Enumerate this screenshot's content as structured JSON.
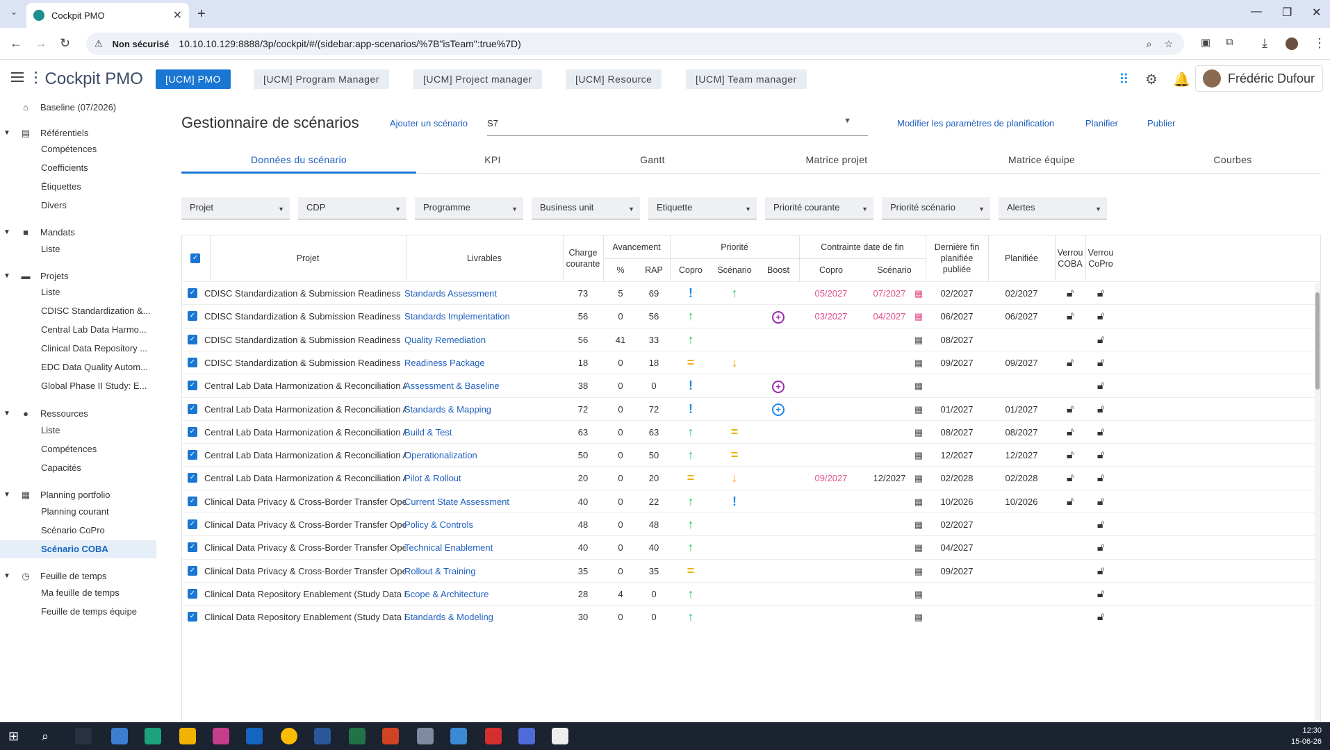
{
  "browser": {
    "tab_title": "Cockpit PMO",
    "security": "Non sécurisé",
    "url": "10.10.10.129:8888/3p/cockpit/#/(sidebar:app-scenarios/%7B\"isTeam\":true%7D)"
  },
  "app": {
    "title": "Cockpit PMO",
    "roles": [
      "[UCM] PMO",
      "[UCM] Program Manager",
      "[UCM] Project manager",
      "[UCM] Resource",
      "[UCM] Team manager"
    ],
    "user": "Frédéric Dufour"
  },
  "sidebar": {
    "baseline": "Baseline (07/2026)",
    "sections": [
      {
        "label": "Référentiels",
        "items": [
          "Compétences",
          "Coefficients",
          "Étiquettes",
          "Divers"
        ]
      },
      {
        "label": "Mandats",
        "items": [
          "Liste"
        ]
      },
      {
        "label": "Projets",
        "items": [
          "Liste",
          "CDISC Standardization &...",
          "Central Lab Data Harmo...",
          "Clinical Data Repository ...",
          "EDC Data Quality Autom...",
          "Global Phase II Study: E..."
        ]
      },
      {
        "label": "Ressources",
        "items": [
          "Liste",
          "Compétences",
          "Capacités"
        ]
      },
      {
        "label": "Planning portfolio",
        "items": [
          "Planning courant",
          "Scénario CoPro",
          "Scénario COBA"
        ]
      },
      {
        "label": "Feuille de temps",
        "items": [
          "Ma feuille de temps",
          "Feuille de temps équipe"
        ]
      }
    ]
  },
  "page": {
    "title": "Gestionnaire de scénarios",
    "add_link": "Ajouter un scénario",
    "scenario": "S7",
    "modify_link": "Modifier les paramètres de planification",
    "plan_link": "Planifier",
    "publish_link": "Publier"
  },
  "tabs": [
    "Données du scénario",
    "KPI",
    "Gantt",
    "Matrice projet",
    "Matrice équipe",
    "Courbes"
  ],
  "filters": [
    "Projet",
    "CDP",
    "Programme",
    "Business unit",
    "Etiquette",
    "Priorité courante",
    "Priorité scénario",
    "Alertes"
  ],
  "headers": {
    "projet": "Projet",
    "livrables": "Livrables",
    "charge": "Charge courante",
    "avancement": "Avancement",
    "pct": "%",
    "rap": "RAP",
    "priorite": "Priorité",
    "copro": "Copro",
    "scenario": "Scénario",
    "boost": "Boost",
    "contrainte": "Contrainte date de fin",
    "c_copro": "Copro",
    "c_scenario": "Scénario",
    "derniere": "Dernière fin planifiée publiée",
    "planifiee": "Planifiée",
    "verrou_coba": "Verrou COBA",
    "verrou_copro": "Verrou CoPro"
  },
  "rows": [
    {
      "projet": "CDISC Standardization & Submission Readiness",
      "livrable": "Standards Assessment",
      "charge": "73",
      "pct": "5",
      "rap": "69",
      "copro": "excl",
      "scen": "up",
      "boost": "",
      "c_copro": "05/2027",
      "c_scen": "07/2027",
      "cal": "pink",
      "derniere": "02/2027",
      "planifiee": "02/2027",
      "l1": true,
      "l2": true
    },
    {
      "projet": "CDISC Standardization & Submission Readiness",
      "livrable": "Standards Implementation",
      "charge": "56",
      "pct": "0",
      "rap": "56",
      "copro": "up",
      "scen": "",
      "boost": "purple",
      "c_copro": "03/2027",
      "c_scen": "04/2027",
      "cal": "pink",
      "derniere": "06/2027",
      "planifiee": "06/2027",
      "l1": true,
      "l2": true
    },
    {
      "projet": "CDISC Standardization & Submission Readiness",
      "livrable": "Quality Remediation",
      "charge": "56",
      "pct": "41",
      "rap": "33",
      "copro": "up",
      "scen": "",
      "boost": "",
      "c_copro": "",
      "c_scen": "",
      "cal": "gray",
      "derniere": "08/2027",
      "planifiee": "",
      "l1": false,
      "l2": true
    },
    {
      "projet": "CDISC Standardization & Submission Readiness",
      "livrable": "Readiness Package",
      "charge": "18",
      "pct": "0",
      "rap": "18",
      "copro": "eq",
      "scen": "down",
      "boost": "",
      "c_copro": "",
      "c_scen": "",
      "cal": "gray",
      "derniere": "09/2027",
      "planifiee": "09/2027",
      "l1": true,
      "l2": true
    },
    {
      "projet": "Central Lab Data Harmonization & Reconciliation Accelerat...",
      "livrable": "Assessment & Baseline",
      "charge": "38",
      "pct": "0",
      "rap": "0",
      "copro": "excl",
      "scen": "",
      "boost": "purple",
      "c_copro": "",
      "c_scen": "",
      "cal": "gray",
      "derniere": "",
      "planifiee": "",
      "l1": false,
      "l2": true
    },
    {
      "projet": "Central Lab Data Harmonization & Reconciliation Accelerat...",
      "livrable": "Standards & Mapping",
      "charge": "72",
      "pct": "0",
      "rap": "72",
      "copro": "excl",
      "scen": "",
      "boost": "blue",
      "c_copro": "",
      "c_scen": "",
      "cal": "gray",
      "derniere": "01/2027",
      "planifiee": "01/2027",
      "l1": true,
      "l2": true
    },
    {
      "projet": "Central Lab Data Harmonization & Reconciliation Accelerat...",
      "livrable": "Build & Test",
      "charge": "63",
      "pct": "0",
      "rap": "63",
      "copro": "up",
      "scen": "eq",
      "boost": "",
      "c_copro": "",
      "c_scen": "",
      "cal": "gray",
      "derniere": "08/2027",
      "planifiee": "08/2027",
      "l1": true,
      "l2": true
    },
    {
      "projet": "Central Lab Data Harmonization & Reconciliation Accelerat...",
      "livrable": "Operationalization",
      "charge": "50",
      "pct": "0",
      "rap": "50",
      "copro": "up",
      "scen": "eq",
      "boost": "",
      "c_copro": "",
      "c_scen": "",
      "cal": "gray",
      "derniere": "12/2027",
      "planifiee": "12/2027",
      "l1": true,
      "l2": true
    },
    {
      "projet": "Central Lab Data Harmonization & Reconciliation Accelerat...",
      "livrable": "Pilot & Rollout",
      "charge": "20",
      "pct": "0",
      "rap": "20",
      "copro": "eq",
      "scen": "down",
      "boost": "",
      "c_copro": "09/2027",
      "c_scen": "12/2027",
      "cal": "gray",
      "derniere": "02/2028",
      "planifiee": "02/2028",
      "l1": true,
      "l2": true,
      "c_scen_dark": true
    },
    {
      "projet": "Clinical Data Privacy & Cross-Border Transfer Operating Mo...",
      "livrable": "Current State Assessment",
      "charge": "40",
      "pct": "0",
      "rap": "22",
      "copro": "up",
      "scen": "excl",
      "boost": "",
      "c_copro": "",
      "c_scen": "",
      "cal": "gray",
      "derniere": "10/2026",
      "planifiee": "10/2026",
      "l1": true,
      "l2": true
    },
    {
      "projet": "Clinical Data Privacy & Cross-Border Transfer Operating Mo...",
      "livrable": "Policy & Controls",
      "charge": "48",
      "pct": "0",
      "rap": "48",
      "copro": "up",
      "scen": "",
      "boost": "",
      "c_copro": "",
      "c_scen": "",
      "cal": "gray",
      "derniere": "02/2027",
      "planifiee": "",
      "l1": false,
      "l2": true
    },
    {
      "projet": "Clinical Data Privacy & Cross-Border Transfer Operating Mo...",
      "livrable": "Technical Enablement",
      "charge": "40",
      "pct": "0",
      "rap": "40",
      "copro": "up",
      "scen": "",
      "boost": "",
      "c_copro": "",
      "c_scen": "",
      "cal": "gray",
      "derniere": "04/2027",
      "planifiee": "",
      "l1": false,
      "l2": true
    },
    {
      "projet": "Clinical Data Privacy & Cross-Border Transfer Operating Mo...",
      "livrable": "Rollout & Training",
      "charge": "35",
      "pct": "0",
      "rap": "35",
      "copro": "eq",
      "scen": "",
      "boost": "",
      "c_copro": "",
      "c_scen": "",
      "cal": "gray",
      "derniere": "09/2027",
      "planifiee": "",
      "l1": false,
      "l2": true
    },
    {
      "projet": "Clinical Data Repository Enablement (Study Data Hub)",
      "livrable": "Scope & Architecture",
      "charge": "28",
      "pct": "4",
      "rap": "0",
      "copro": "up",
      "scen": "",
      "boost": "",
      "c_copro": "",
      "c_scen": "",
      "cal": "gray",
      "derniere": "",
      "planifiee": "",
      "l1": false,
      "l2": true
    },
    {
      "projet": "Clinical Data Repository Enablement (Study Data Hub)",
      "livrable": "Standards & Modeling",
      "charge": "30",
      "pct": "0",
      "rap": "0",
      "copro": "up",
      "scen": "",
      "boost": "",
      "c_copro": "",
      "c_scen": "",
      "cal": "gray",
      "derniere": "",
      "planifiee": "",
      "l1": false,
      "l2": true
    }
  ],
  "taskbar": {
    "time": "12:30",
    "date": "15-06-26"
  }
}
